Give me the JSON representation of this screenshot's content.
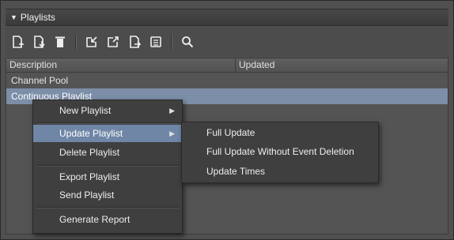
{
  "panel": {
    "title": "Playlists",
    "caret": "▼"
  },
  "toolbar": {
    "buttons": [
      {
        "icon": "new-playlist-icon"
      },
      {
        "icon": "import-icon"
      },
      {
        "icon": "delete-icon"
      },
      {
        "icon": "export-in-icon"
      },
      {
        "icon": "export-out-icon"
      },
      {
        "icon": "send-icon"
      },
      {
        "icon": "report-icon"
      },
      {
        "icon": "search-icon"
      }
    ]
  },
  "table": {
    "headers": [
      "Description",
      "Updated"
    ],
    "rows": [
      "Channel Pool",
      "Continuous Playlist"
    ]
  },
  "context_menu": {
    "items": [
      {
        "label": "New Playlist",
        "submenu": true
      },
      {
        "label": "Update Playlist",
        "submenu": true,
        "highlighted": true
      },
      {
        "label": "Delete Playlist"
      },
      {
        "label": "Export Playlist"
      },
      {
        "label": "Send Playlist"
      },
      {
        "label": "Generate Report"
      }
    ],
    "arrow": "▶"
  },
  "submenu": {
    "items": [
      {
        "label": "Full Update"
      },
      {
        "label": "Full Update Without Event Deletion"
      },
      {
        "label": "Update Times"
      }
    ]
  },
  "colors": {
    "selection": "#7c8ea8",
    "menu_highlight": "#6f86a6",
    "menu_bg": "#3f3f3f"
  }
}
